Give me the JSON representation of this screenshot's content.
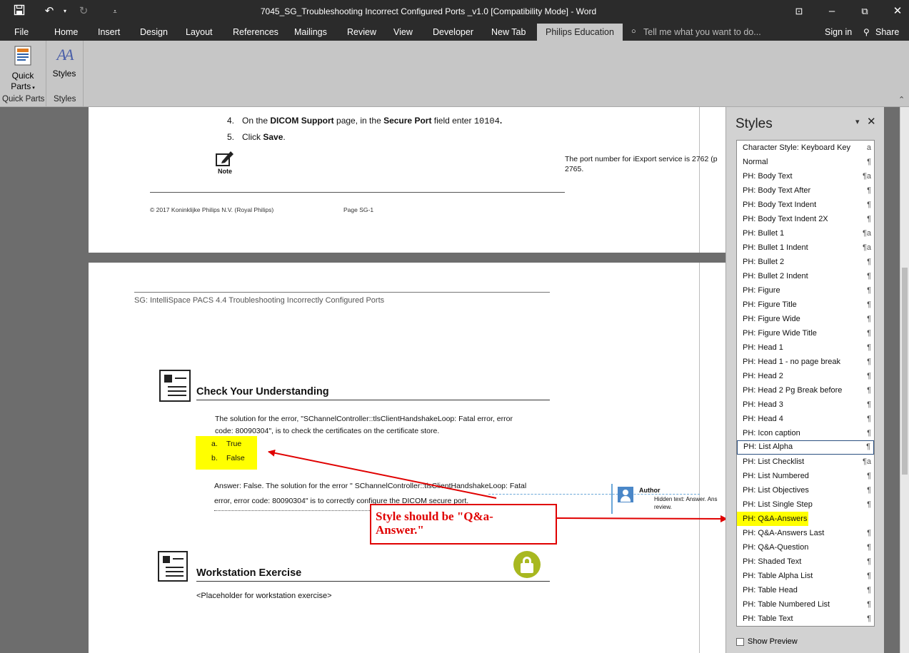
{
  "titlebar": {
    "title": "7045_SG_Troubleshooting Incorrect Configured Ports _v1.0 [Compatibility Mode] - Word"
  },
  "tabs": {
    "file": "File",
    "home": "Home",
    "insert": "Insert",
    "design": "Design",
    "layout": "Layout",
    "references": "References",
    "mailings": "Mailings",
    "review": "Review",
    "view": "View",
    "developer": "Developer",
    "new_tab": "New Tab",
    "philips": "Philips Education",
    "tell_me": "Tell me what you want to do...",
    "sign_in": "Sign in",
    "share": "Share"
  },
  "ribbon": {
    "quick_parts_1": "Quick",
    "quick_parts_2": "Parts",
    "styles_btn": "Styles",
    "group_quick_parts": "Quick Parts",
    "group_styles": "Styles"
  },
  "page1": {
    "step4_num": "4.",
    "step4_a": "On the ",
    "step4_b": "DICOM Support",
    "step4_c": " page, in the ",
    "step4_d": "Secure Port",
    "step4_e": " field enter ",
    "step4_f": "10104",
    "step4_g": ".",
    "step5_num": "5.",
    "step5_a": "Click ",
    "step5_b": "Save",
    "step5_c": ".",
    "note_label": "Note",
    "side_note_1": "The port number for iExport service is 2762 (p",
    "side_note_2": "2765.",
    "footer_left": "© 2017 Koninklijke Philips N.V. (Royal Philips)",
    "footer_page": "Page SG-1"
  },
  "page2": {
    "header": "SG: IntelliSpace PACS 4.4  Troubleshooting Incorrectly Configured Ports",
    "heading1": "Check Your Understanding",
    "question_1": "The solution for the error, \"SChannelController::tlsClientHandshakeLoop: Fatal error, error",
    "question_2": "code: 80090304\", is to check the certificates on the certificate store.",
    "opt_a_letter": "a.",
    "opt_a": "True",
    "opt_b_letter": "b.",
    "opt_b": "False",
    "answer_1": "Answer: False. The solution for the error \" SChannelController::tlsClientHandshakeLoop: Fatal",
    "answer_2": "error, error code: 80090304\" is to correctly configure the DICOM secure port.",
    "heading2": "Workstation Exercise",
    "placeholder": "<Placeholder for workstation exercise>",
    "comment_author": "Author",
    "comment_text_1": "Hidden text: Answer. Ans",
    "comment_text_2": "review."
  },
  "callout": {
    "line1": "Style should be \"Q&a-",
    "line2": "Answer.\""
  },
  "styles_pane": {
    "title": "Styles",
    "show_preview": "Show Preview",
    "items": [
      {
        "label": "Character Style: Keyboard Key",
        "mark": "a"
      },
      {
        "label": "Normal",
        "mark": "¶"
      },
      {
        "label": "PH: Body Text",
        "mark": "¶a"
      },
      {
        "label": "PH: Body Text After",
        "mark": "¶"
      },
      {
        "label": "PH: Body Text Indent",
        "mark": "¶"
      },
      {
        "label": "PH: Body Text Indent 2X",
        "mark": "¶"
      },
      {
        "label": "PH: Bullet 1",
        "mark": "¶a"
      },
      {
        "label": "PH: Bullet 1 Indent",
        "mark": "¶a"
      },
      {
        "label": "PH: Bullet 2",
        "mark": "¶"
      },
      {
        "label": "PH: Bullet 2 Indent",
        "mark": "¶"
      },
      {
        "label": "PH: Figure",
        "mark": "¶"
      },
      {
        "label": "PH: Figure Title",
        "mark": "¶"
      },
      {
        "label": "PH: Figure Wide",
        "mark": "¶"
      },
      {
        "label": "PH: Figure Wide Title",
        "mark": "¶"
      },
      {
        "label": "PH: Head 1",
        "mark": "¶"
      },
      {
        "label": "PH: Head 1 - no page break",
        "mark": "¶"
      },
      {
        "label": "PH: Head 2",
        "mark": "¶"
      },
      {
        "label": "PH: Head 2 Pg Break before",
        "mark": "¶"
      },
      {
        "label": "PH: Head 3",
        "mark": "¶"
      },
      {
        "label": "PH: Head 4",
        "mark": "¶"
      },
      {
        "label": "PH: Icon caption",
        "mark": "¶"
      },
      {
        "label": "PH: List Alpha",
        "mark": "¶",
        "selected": true
      },
      {
        "label": "PH: List Checklist",
        "mark": "¶a"
      },
      {
        "label": "PH: List Numbered",
        "mark": "¶"
      },
      {
        "label": "PH: List Objectives",
        "mark": "¶"
      },
      {
        "label": "PH: List Single Step",
        "mark": "¶"
      },
      {
        "label": "PH: Q&A-Answers",
        "mark": "¶",
        "highlighted": true
      },
      {
        "label": "PH: Q&A-Answers Last",
        "mark": "¶"
      },
      {
        "label": "PH: Q&A-Question",
        "mark": "¶"
      },
      {
        "label": "PH: Shaded Text",
        "mark": "¶"
      },
      {
        "label": "PH: Table Alpha List",
        "mark": "¶"
      },
      {
        "label": "PH: Table Head",
        "mark": "¶"
      },
      {
        "label": "PH: Table Numbered List",
        "mark": "¶"
      },
      {
        "label": "PH: Table Text",
        "mark": "¶"
      }
    ]
  },
  "colors": {
    "highlight": "#ffff00",
    "annotation": "#e00000",
    "titlebar": "#2b2b2b",
    "ribbon": "#c6c6c6"
  }
}
